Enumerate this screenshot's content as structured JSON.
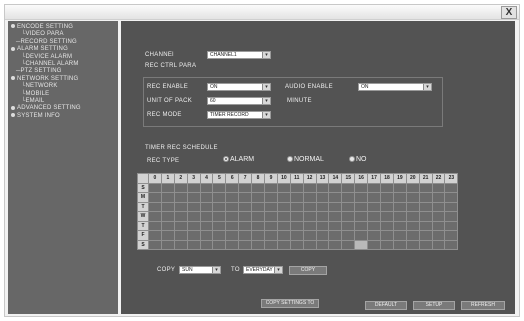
{
  "window": {
    "close_glyph": "X"
  },
  "sidebar": {
    "items": [
      {
        "label": "ENCODE SETTING",
        "level": 0
      },
      {
        "label": "VIDEO PARA",
        "level": 2
      },
      {
        "label": "RECORD SETTING",
        "level": 1
      },
      {
        "label": "ALARM SETTING",
        "level": 0
      },
      {
        "label": "DEVICE ALARM",
        "level": 2
      },
      {
        "label": "CHANNEL ALARM",
        "level": 2
      },
      {
        "label": "PTZ SETTING",
        "level": 1
      },
      {
        "label": "NETWORK SETTING",
        "level": 0
      },
      {
        "label": "NETWORK",
        "level": 2
      },
      {
        "label": "MOBILE",
        "level": 2
      },
      {
        "label": "EMAIL",
        "level": 2
      },
      {
        "label": "ADVANCED SETTING",
        "level": 0
      },
      {
        "label": "SYSTEM INFO",
        "level": 0
      }
    ]
  },
  "main": {
    "channel_label": "CHANNEl",
    "channel_value": "CHANNEL1",
    "rec_ctrl_title": "REC CTRL PARA",
    "rec_enable_label": "REC ENABLE",
    "rec_enable_value": "ON",
    "audio_enable_label": "AUDIO ENABLE",
    "audio_enable_value": "ON",
    "unit_of_pack_label": "UNIT OF PACK",
    "unit_of_pack_value": "60",
    "minute_label": "MINUTE",
    "rec_mode_label": "REC MODE",
    "rec_mode_value": "TIMER RECORD",
    "timer_title": "TIMER REC SCHEDULE",
    "rec_type_label": "REC TYPE",
    "rec_type_options": [
      "ALARM",
      "NORMAL",
      "NO"
    ],
    "rec_type_selected": "ALARM",
    "hours": [
      "0",
      "1",
      "2",
      "3",
      "4",
      "5",
      "6",
      "7",
      "8",
      "9",
      "10",
      "11",
      "12",
      "13",
      "14",
      "15",
      "16",
      "17",
      "18",
      "19",
      "20",
      "21",
      "22",
      "23"
    ],
    "days": [
      "S",
      "M",
      "T",
      "W",
      "T",
      "F",
      "S"
    ],
    "copy_label": "COPY",
    "copy_from_value": "SUN",
    "to_label": "TO",
    "copy_to_value": "EVERYDAY",
    "copy_button": "COPY",
    "copy_settings_button": "COPY SETTINGS TO",
    "default_button": "DEFAULT",
    "setup_button": "SETUP",
    "refresh_button": "REFRESH"
  }
}
